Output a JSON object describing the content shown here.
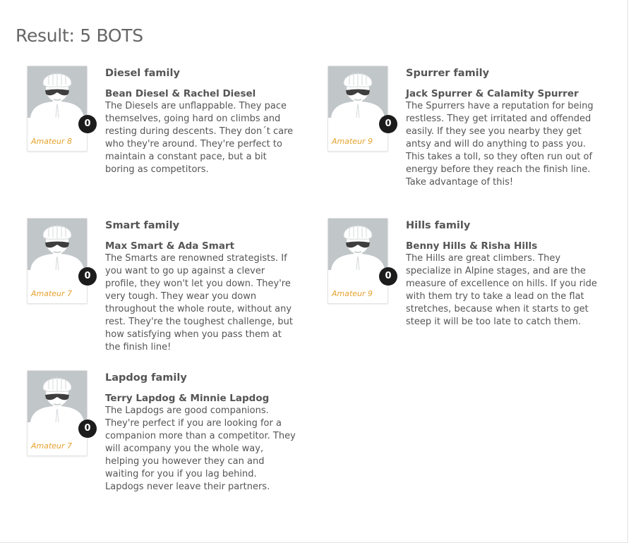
{
  "result": {
    "title": "Result: 5 BOTS"
  },
  "bots": [
    {
      "family": "Diesel family",
      "members": "Bean Diesel & Rachel Diesel",
      "description": "The Diesels are unflappable. They pace themselves, going hard on climbs and resting during descents. They don´t care who they're around. They're perfect to maintain a constant pace, but a bit boring as competitors.",
      "level": "Amateur 8",
      "badge": "0"
    },
    {
      "family": "Spurrer family",
      "members": "Jack Spurrer & Calamity Spurrer",
      "description": "The Spurrers have a reputation for being restless. They get irritated and offended easily. If they see you nearby they get antsy and will do anything to pass you. This takes a toll, so they often run out of energy before they reach the finish line. Take advantage of this!",
      "level": "Amateur 9",
      "badge": "0"
    },
    {
      "family": "Smart family",
      "members": "Max Smart & Ada Smart",
      "description": "The Smarts are renowned strategists. If you want to go up against a clever profile, they won't let you down. They're very tough. They wear you down throughout the whole route, without any rest. They're the toughest challenge, but how satisfying when you pass them at the finish line!",
      "level": "Amateur 7",
      "badge": "0"
    },
    {
      "family": "Hills family",
      "members": "Benny Hills & Risha Hills",
      "description": "The Hills are great climbers. They specialize in Alpine stages, and are the measure of excellence on hills. If you ride with them try to take a lead on the flat stretches, because when it starts to get steep it will be too late to catch them.",
      "level": "Amateur 9",
      "badge": "0"
    },
    {
      "family": "Lapdog family",
      "members": "Terry Lapdog & Minnie Lapdog",
      "description": "The Lapdogs are good companions. They're perfect if you are looking for a companion more than a competitor. They will acompany you the whole way, helping you however they can and waiting for you if you lag behind. Lapdogs never leave their partners.",
      "level": "Amateur 7",
      "badge": "0"
    }
  ]
}
